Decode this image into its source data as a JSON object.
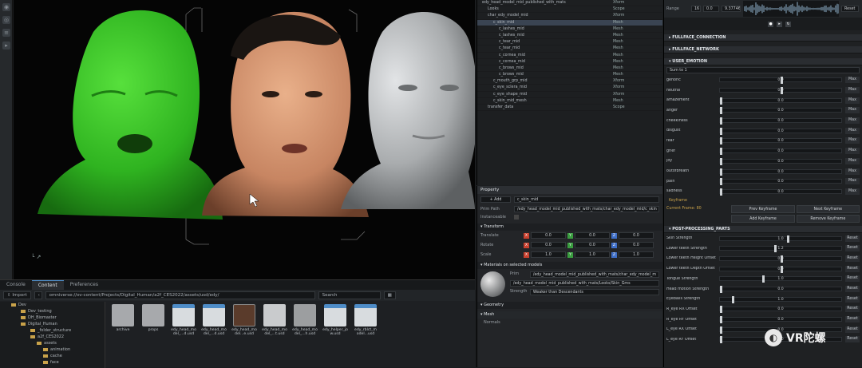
{
  "toolbar_icons": [
    "camera-icon",
    "eye-icon",
    "layers-icon",
    "play-icon"
  ],
  "content_browser": {
    "tabs": [
      "Console",
      "Content",
      "Preferences"
    ],
    "active_tab": "Content",
    "import_label": "Import",
    "path_root": "omniverse://ov-content/Projects/Digital_Human/a2f_CES2022/assets/usd/edy/",
    "search_placeholder": "Search",
    "tree": [
      "Dev",
      "Dev_testing",
      "DH_Biomaster",
      "Digital_Human",
      "_folder_structure",
      "a2f_CES2022",
      "assets",
      "animation",
      "cache",
      "face"
    ],
    "files": [
      {
        "name": "archive",
        "kind": "folder"
      },
      {
        "name": "props",
        "kind": "folder"
      },
      {
        "name": "edy_head_mo del_...d.usd",
        "kind": "usd"
      },
      {
        "name": "edy_head_mo del_...d.usd",
        "kind": "usd"
      },
      {
        "name": "edy_head_mo del...e.usd",
        "kind": "face"
      },
      {
        "name": "edy_head_mo del_...t.usd",
        "kind": "grey"
      },
      {
        "name": "edy_head_mo del_...h.usd",
        "kind": "grey2"
      },
      {
        "name": "edy_helper_jo w.usd",
        "kind": "usd"
      },
      {
        "name": "edy_rblct_m odel...usd",
        "kind": "usd"
      }
    ]
  },
  "stage": {
    "rows": [
      {
        "name": "edy_head_model_mid_published_with_mats",
        "type": "Xform",
        "indent": 0
      },
      {
        "name": "Looks",
        "type": "Scope",
        "indent": 1
      },
      {
        "name": "char_edy_model_mid",
        "type": "Xform",
        "indent": 1
      },
      {
        "name": "c_skin_mid",
        "type": "Mesh",
        "indent": 2,
        "selected": true
      },
      {
        "name": "c_lashes_mid",
        "type": "Mesh",
        "indent": 3
      },
      {
        "name": "c_lashes_mid",
        "type": "Mesh",
        "indent": 3
      },
      {
        "name": "c_tear_mid",
        "type": "Mesh",
        "indent": 3
      },
      {
        "name": "c_tear_mid",
        "type": "Mesh",
        "indent": 3
      },
      {
        "name": "c_cornea_mid",
        "type": "Mesh",
        "indent": 3
      },
      {
        "name": "c_cornea_mid",
        "type": "Mesh",
        "indent": 3
      },
      {
        "name": "c_brows_mid",
        "type": "Mesh",
        "indent": 3
      },
      {
        "name": "c_brows_mid",
        "type": "Mesh",
        "indent": 3
      },
      {
        "name": "c_mouth_grp_mid",
        "type": "Xform",
        "indent": 2
      },
      {
        "name": "c_eye_sclera_mid",
        "type": "Xform",
        "indent": 2
      },
      {
        "name": "c_eye_shape_mid",
        "type": "Xform",
        "indent": 2
      },
      {
        "name": "c_skin_mid_mesh",
        "type": "Mesh",
        "indent": 2
      },
      {
        "name": "transfer_data",
        "type": "Scope",
        "indent": 1
      }
    ]
  },
  "property": {
    "tab": "Property",
    "add_label": "+ Add",
    "prim_name": "c_skin_mid",
    "prim_path_label": "Prim Path",
    "prim_path": "/edy_head_model_mid_published_with_mats/char_edy_model_mid/c_skin",
    "instanceable_label": "Instanceable",
    "transform_label": "Transform",
    "translate_label": "Translate",
    "rotate_label": "Rotate",
    "scale_label": "Scale",
    "translate": [
      "0.0",
      "0.0",
      "0.0"
    ],
    "rotate": [
      "0.0",
      "0.0",
      "0.0"
    ],
    "scale": [
      "1.0",
      "1.0",
      "1.0"
    ],
    "materials_label": "Materials on selected models",
    "from_label": "Prim",
    "material_path": "/edy_head_model_mid_published_with_mats/char_edy_model_m",
    "material_path2": "/edy_head_model_mid_published_with_mats/Looks/Skin_Gms",
    "strength_label": "Strength",
    "strength_value": "Weaker than Descendants",
    "geometry_label": "Geometry",
    "mesh_label": "Mesh",
    "normals_label": "Normals"
  },
  "right": {
    "range_label": "Range",
    "range_start": "16",
    "range_mid": "0.0",
    "range_end": "9.37746",
    "reset_label": "Reset",
    "sections": [
      "FULLFACE_CONNECTION",
      "FULLFACE_NETWORK",
      "USER_EMOTION"
    ],
    "sum_label": "Sum to 1",
    "emotions": [
      {
        "name": "genoric",
        "value": "0.0",
        "btn": "Max",
        "pos": 0.5
      },
      {
        "name": "neutral",
        "value": "0.0",
        "btn": "Max",
        "pos": 0.5
      },
      {
        "name": "amazement",
        "value": "0.0",
        "btn": "Max",
        "pos": 0.0
      },
      {
        "name": "anger",
        "value": "0.0",
        "btn": "Max",
        "pos": 0.0
      },
      {
        "name": "cheekiness",
        "value": "0.0",
        "btn": "Max",
        "pos": 0.0
      },
      {
        "name": "disgust",
        "value": "0.0",
        "btn": "Max",
        "pos": 0.0
      },
      {
        "name": "fear",
        "value": "0.0",
        "btn": "Max",
        "pos": 0.0
      },
      {
        "name": "grief",
        "value": "0.0",
        "btn": "Max",
        "pos": 0.0
      },
      {
        "name": "joy",
        "value": "0.0",
        "btn": "Max",
        "pos": 0.0
      },
      {
        "name": "outofbreath",
        "value": "0.0",
        "btn": "Max",
        "pos": 0.0
      },
      {
        "name": "pain",
        "value": "0.0",
        "btn": "Max",
        "pos": 0.0
      },
      {
        "name": "sadness",
        "value": "0.0",
        "btn": "Max",
        "pos": 0.0
      }
    ],
    "keyframe_label": "Keyframe",
    "current_frame": "Current Frame: 80",
    "prev_kf": "Prev Keyframe",
    "next_kf": "Next Keyframe",
    "add_kf": "Add Keyframe",
    "remove_kf": "Remove Keyframe",
    "post_label": "POST-PROCESSING_PARTS",
    "post": [
      {
        "name": "Skin Strength",
        "value": "1.0",
        "btn": "Reset",
        "pos": 0.55
      },
      {
        "name": "Lower teeth Strength",
        "value": "1.2",
        "btn": "Reset",
        "pos": 0.45
      },
      {
        "name": "Lower teeth Height Offset",
        "value": "0.0",
        "btn": "Reset",
        "pos": 0.5
      },
      {
        "name": "Lower teeth Depth Offset",
        "value": "0.0",
        "btn": "Reset",
        "pos": 0.5
      },
      {
        "name": "Tongue Strength",
        "value": "1.0",
        "btn": "Reset",
        "pos": 0.35
      },
      {
        "name": "Head motion Strength",
        "value": "0.0",
        "btn": "Reset",
        "pos": 0.0
      },
      {
        "name": "Eyeballs Strength",
        "value": "1.0",
        "btn": "Reset",
        "pos": 0.1
      },
      {
        "name": "R_eye RX Offset",
        "value": "0.0",
        "btn": "Reset",
        "pos": 0.0
      },
      {
        "name": "R_eye RY Offset",
        "value": "0.0",
        "btn": "Reset",
        "pos": 0.0
      },
      {
        "name": "L_eye RX Offset",
        "value": "0.0",
        "btn": "Reset",
        "pos": 0.0
      },
      {
        "name": "L_eye RY Offset",
        "value": "0.0",
        "btn": "Reset",
        "pos": 0.0
      }
    ]
  },
  "watermark": "VR陀螺",
  "colors": {
    "green_head": "#39c22a",
    "grey_head": "#b9bbbd",
    "accent": "#4e8cc7",
    "waveform": "#8fb3cc"
  }
}
